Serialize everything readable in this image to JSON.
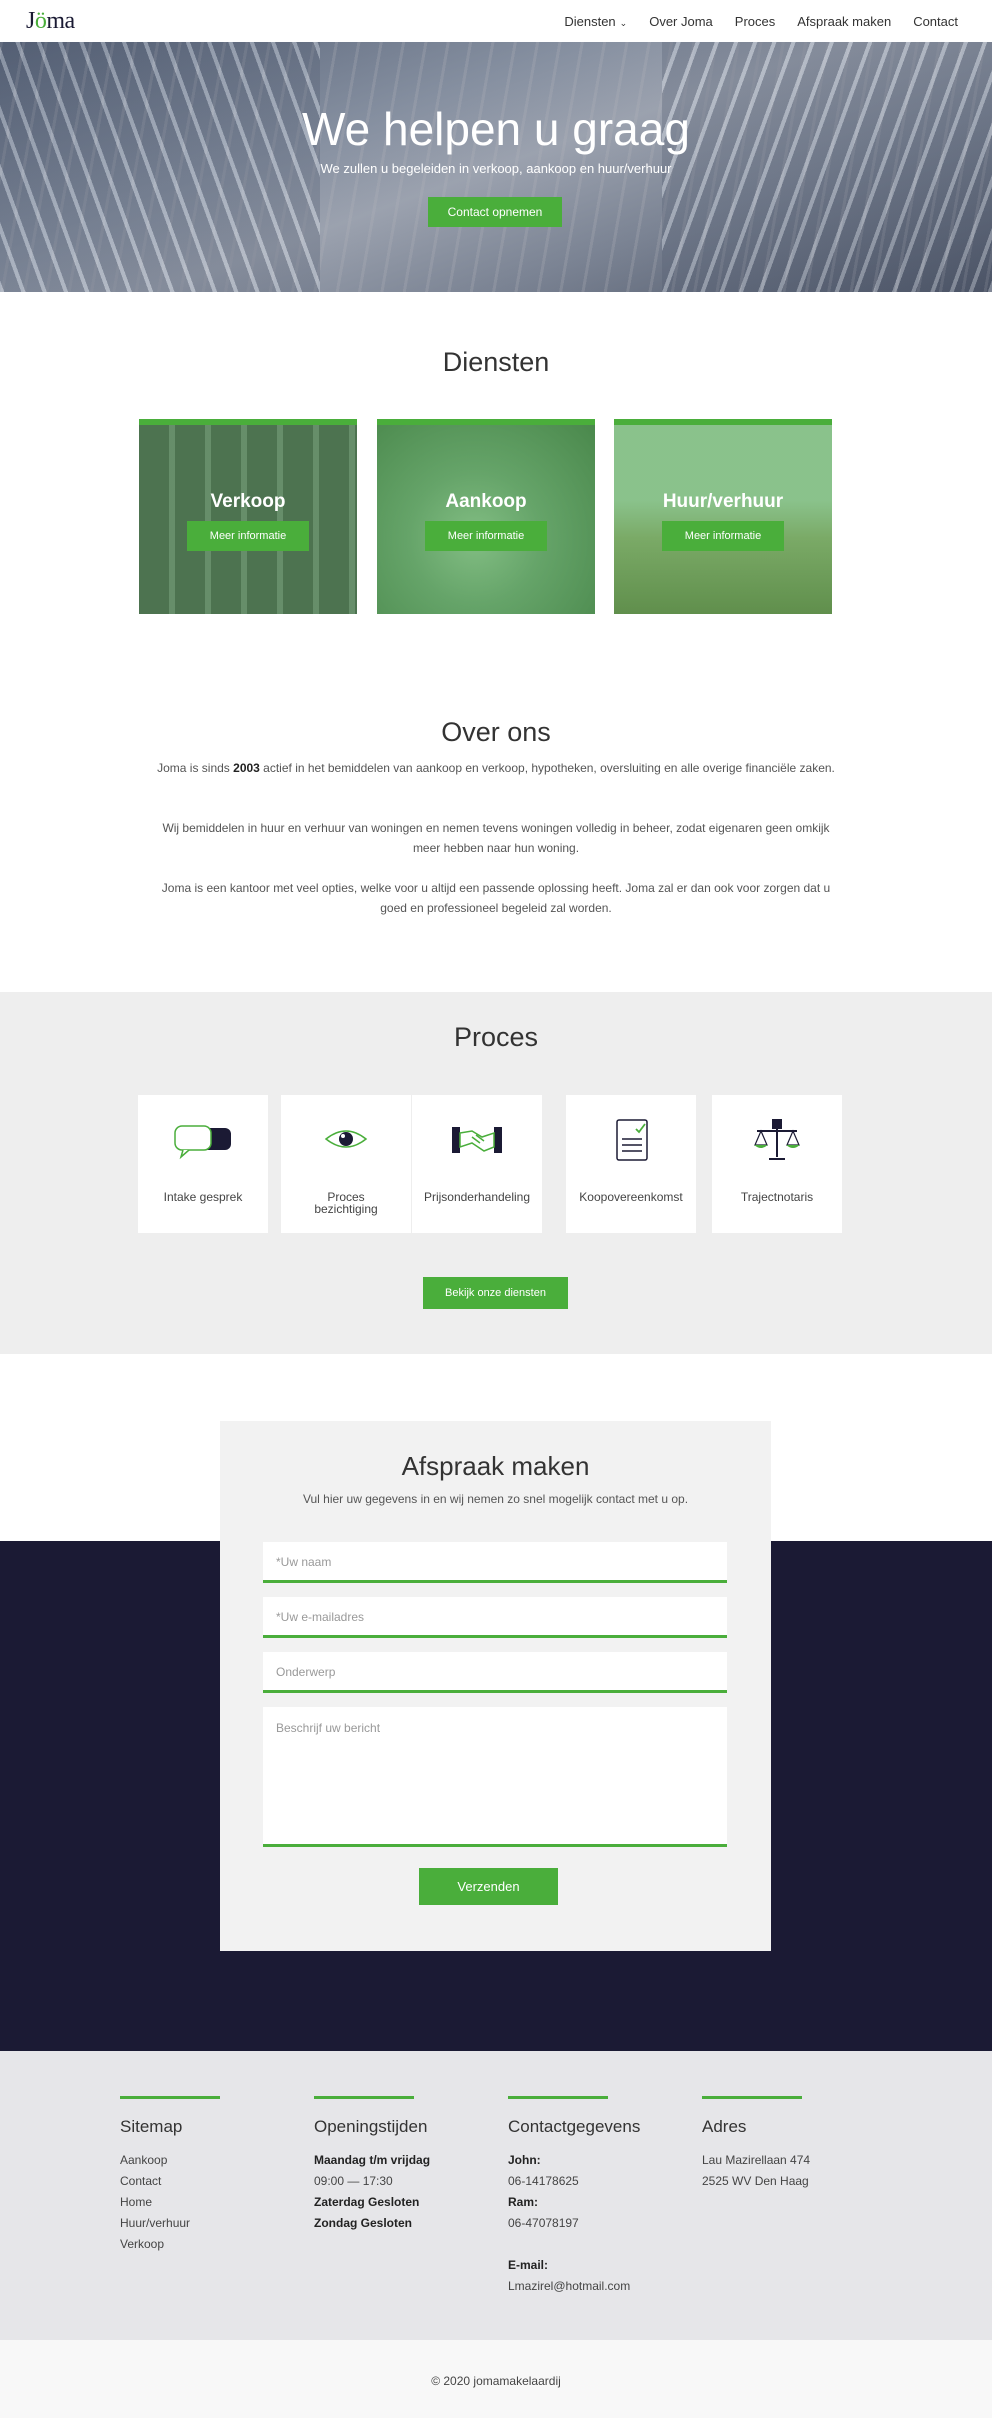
{
  "header": {
    "logo": "Joma",
    "nav": [
      "Diensten",
      "Over Joma",
      "Proces",
      "Afspraak maken",
      "Contact"
    ]
  },
  "hero": {
    "title": "We helpen u graag",
    "subtitle": "We zullen u begeleiden in verkoop, aankoop en huur/verhuur",
    "button": "Contact opnemen"
  },
  "diensten": {
    "title": "Diensten",
    "cards": [
      {
        "title": "Verkoop",
        "button": "Meer informatie"
      },
      {
        "title": "Aankoop",
        "button": "Meer informatie"
      },
      {
        "title": "Huur/verhuur",
        "button": "Meer informatie"
      }
    ]
  },
  "over_ons": {
    "title": "Over ons",
    "p1_pre": "Joma is sinds ",
    "p1_bold": "2003",
    "p1_post": " actief in het bemiddelen van aankoop en verkoop, hypotheken, oversluiting en alle overige financiële zaken.",
    "p2": "Wij bemiddelen in huur en verhuur van woningen en nemen tevens woningen volledig in beheer, zodat eigenaren geen omkijk meer hebben naar hun woning.",
    "p3": "Joma is een kantoor met veel opties, welke voor u altijd een passende oplossing heeft. Joma zal er dan ook voor zorgen dat u goed en professioneel begeleid zal worden."
  },
  "proces": {
    "title": "Proces",
    "steps": [
      {
        "label": "Intake gesprek",
        "icon": "chat-bubbles-icon"
      },
      {
        "label": "Proces bezichtiging",
        "icon": "eye-icon"
      },
      {
        "label": "Prijsonderhandeling",
        "icon": "handshake-icon"
      },
      {
        "label": "Koopovereenkomst",
        "icon": "document-icon"
      },
      {
        "label": "Trajectnotaris",
        "icon": "scales-icon"
      }
    ],
    "button": "Bekijk onze diensten"
  },
  "afspraak": {
    "title": "Afspraak maken",
    "subtitle": "Vul hier uw gegevens in en wij nemen zo snel mogelijk contact met u op.",
    "name_placeholder": "*Uw naam",
    "email_placeholder": "*Uw e-mailadres",
    "subject_placeholder": "Onderwerp",
    "message_placeholder": "Beschrijf uw bericht",
    "submit": "Verzenden"
  },
  "footer": {
    "sitemap": {
      "title": "Sitemap",
      "items": [
        "Aankoop",
        "Contact",
        "Home",
        "Huur/verhuur",
        "Verkoop"
      ]
    },
    "openingstijden": {
      "title": "Openingstijden",
      "weekdays_label": "Maandag t/m vrijdag",
      "weekdays_hours": "09:00 — 17:30",
      "saturday": "Zaterdag Gesloten",
      "sunday": "Zondag Gesloten"
    },
    "contact": {
      "title": "Contactgegevens",
      "john_label": "John:",
      "john_phone": "06-14178625",
      "ram_label": "Ram:",
      "ram_phone": "06-47078197",
      "email_label": "E-mail:",
      "email": "Lmazirel@hotmail.com"
    },
    "adres": {
      "title": "Adres",
      "street": "Lau Mazirellaan 474",
      "city": "2525 WV Den Haag"
    },
    "copyright": "© 2020 jomamakelaardij"
  },
  "colors": {
    "accent": "#4aae3b",
    "navy": "#1b1a34"
  }
}
